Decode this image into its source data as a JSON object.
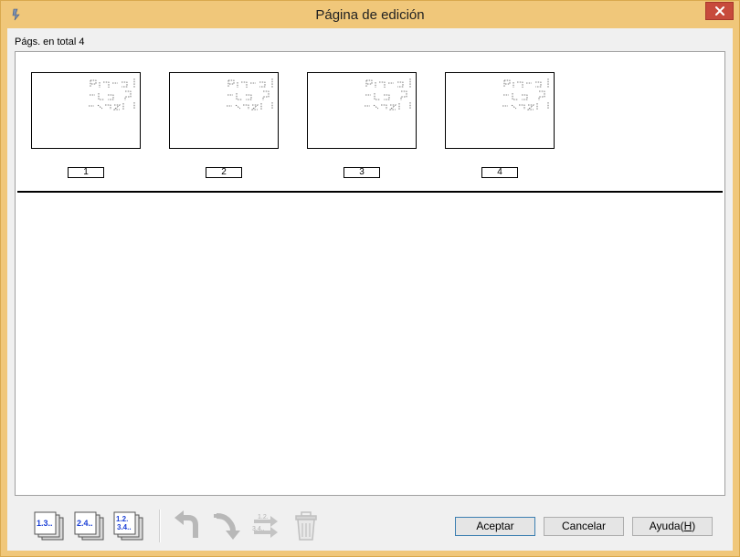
{
  "window": {
    "title": "Página de edición",
    "icons": {
      "app": "scanner-app-icon",
      "close": "close-icon"
    }
  },
  "panel": {
    "total_label": "Págs. en total 4",
    "pages": [
      {
        "number": "1"
      },
      {
        "number": "2"
      },
      {
        "number": "3"
      },
      {
        "number": "4"
      }
    ]
  },
  "toolbar": {
    "tools": [
      {
        "name": "select-odd-pages-icon",
        "text": "1.3.."
      },
      {
        "name": "select-even-pages-icon",
        "text": "2.4.."
      },
      {
        "name": "select-all-pages-icon",
        "text": "1.2. 3.4.."
      },
      {
        "name": "rotate-left-icon",
        "enabled": false
      },
      {
        "name": "rotate-right-icon",
        "enabled": false
      },
      {
        "name": "swap-pages-icon",
        "enabled": false
      },
      {
        "name": "delete-trash-icon",
        "enabled": false
      }
    ]
  },
  "buttons": {
    "accept": "Aceptar",
    "cancel": "Cancelar",
    "help": "Ayuda(",
    "help_hotkey": "H",
    "help_close": ")"
  }
}
